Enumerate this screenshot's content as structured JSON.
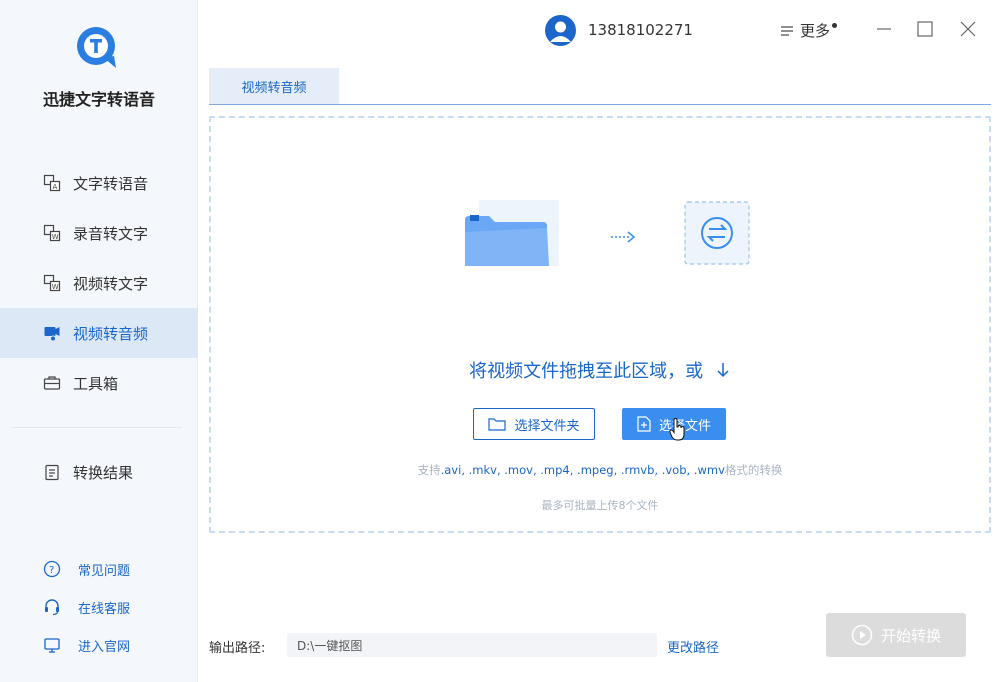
{
  "app": {
    "name": "迅捷文字转语音"
  },
  "sidebar": {
    "items": [
      {
        "label": "文字转语音",
        "icon": "text-to-speech-icon"
      },
      {
        "label": "录音转文字",
        "icon": "recording-to-text-icon"
      },
      {
        "label": "视频转文字",
        "icon": "video-to-text-icon"
      },
      {
        "label": "视频转音频",
        "icon": "video-to-audio-icon",
        "active": true
      },
      {
        "label": "工具箱",
        "icon": "toolbox-icon"
      }
    ],
    "result": {
      "label": "转换结果",
      "icon": "result-icon"
    },
    "links": [
      {
        "label": "常见问题",
        "icon": "question-icon"
      },
      {
        "label": "在线客服",
        "icon": "headset-icon"
      },
      {
        "label": "进入官网",
        "icon": "monitor-icon"
      }
    ]
  },
  "header": {
    "user": "13818102271",
    "more_label": "更多"
  },
  "tab": {
    "label": "视频转音频"
  },
  "dropzone": {
    "prompt": "将视频文件拖拽至此区域，或",
    "select_folder": "选择文件夹",
    "select_file": "选择文件",
    "support_prefix": "支持",
    "support_formats": ".avi, .mkv, .mov, .mp4, .mpeg, .rmvb, .vob, .wmv",
    "support_suffix": "格式的转换",
    "limit": "最多可批量上传8个文件"
  },
  "output": {
    "label": "输出路径:",
    "path": "D:\\一键抠图",
    "change_label": "更改路径"
  },
  "start_button": {
    "label": "开始转换"
  },
  "colors": {
    "accent": "#1a66c9",
    "button": "#3a8ef0",
    "sidebar_bg": "#f4f7fb",
    "active_bg": "#dde8f6"
  }
}
